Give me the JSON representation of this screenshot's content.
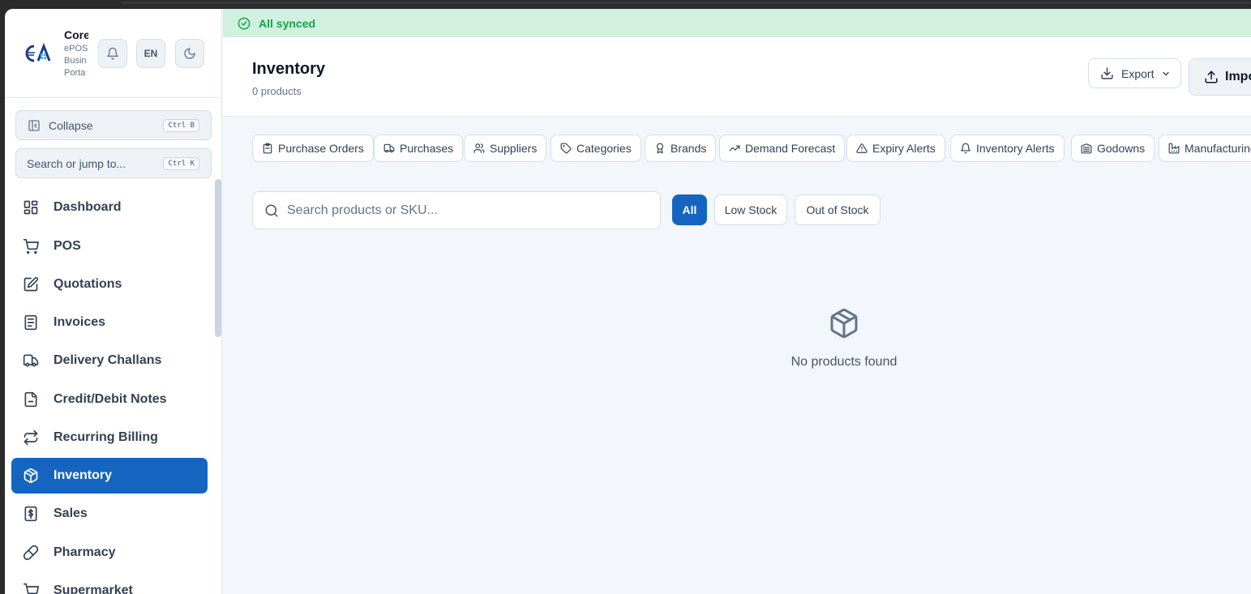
{
  "brand": {
    "name": "Core",
    "sub_lines": [
      "ePOS",
      "Busin",
      "Porta"
    ]
  },
  "header_buttons": {
    "language": "EN"
  },
  "sidebar": {
    "collapse": {
      "label": "Collapse",
      "shortcut": "Ctrl B"
    },
    "jump": {
      "placeholder": "Search or jump to...",
      "shortcut": "Ctrl K"
    },
    "items": [
      {
        "label": "Dashboard",
        "icon": "dashboard-icon"
      },
      {
        "label": "POS",
        "icon": "cart-icon"
      },
      {
        "label": "Quotations",
        "icon": "edit-document-icon"
      },
      {
        "label": "Invoices",
        "icon": "receipt-icon"
      },
      {
        "label": "Delivery Challans",
        "icon": "truck-icon"
      },
      {
        "label": "Credit/Debit Notes",
        "icon": "document-icon"
      },
      {
        "label": "Recurring Billing",
        "icon": "repeat-icon"
      },
      {
        "label": "Inventory",
        "icon": "package-icon",
        "active": true
      },
      {
        "label": "Sales",
        "icon": "dollar-receipt-icon"
      },
      {
        "label": "Pharmacy",
        "icon": "pill-icon"
      },
      {
        "label": "Supermarket",
        "icon": "cart-icon"
      }
    ]
  },
  "status": {
    "sync": "All synced"
  },
  "page": {
    "title": "Inventory",
    "subtitle": "0 products"
  },
  "actions": {
    "export": "Export",
    "import": "Import"
  },
  "subnav": [
    {
      "label": "Purchase Orders",
      "icon": "clipboard-icon"
    },
    {
      "label": "Purchases",
      "icon": "truck-icon"
    },
    {
      "label": "Suppliers",
      "icon": "users-icon"
    },
    {
      "label": "Categories",
      "icon": "tag-icon"
    },
    {
      "label": "Brands",
      "icon": "award-icon"
    },
    {
      "label": "Demand Forecast",
      "icon": "trending-up-icon"
    },
    {
      "label": "Expiry Alerts",
      "icon": "warning-icon"
    },
    {
      "label": "Inventory Alerts",
      "icon": "bell-icon"
    },
    {
      "label": "Godowns",
      "icon": "warehouse-icon"
    },
    {
      "label": "Manufacturing",
      "icon": "factory-icon"
    }
  ],
  "search": {
    "placeholder": "Search products or SKU..."
  },
  "filters": [
    {
      "label": "All",
      "active": true
    },
    {
      "label": "Low Stock",
      "active": false
    },
    {
      "label": "Out of Stock",
      "active": false
    }
  ],
  "empty_state": {
    "message": "No products found",
    "icon": "package-icon"
  },
  "colors": {
    "accent": "#1565c0",
    "sync_bg": "#d1f0e0",
    "sync_text": "#16a34a"
  }
}
